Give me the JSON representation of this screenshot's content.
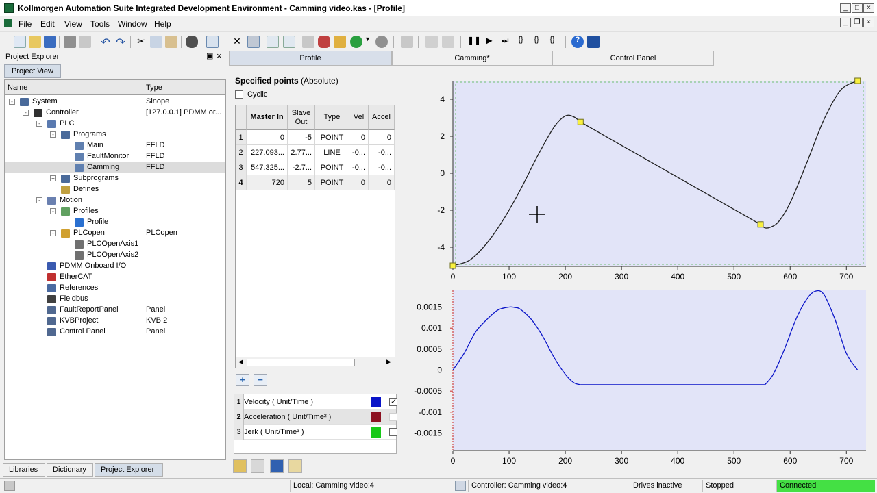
{
  "window": {
    "title": "Kollmorgen Automation Suite Integrated Development Environment - Camming video.kas - [Profile]"
  },
  "menu": [
    "File",
    "Edit",
    "View",
    "Tools",
    "Window",
    "Help"
  ],
  "left_panel": {
    "title": "Project Explorer",
    "tab": "Project View",
    "columns": {
      "name": "Name",
      "type": "Type"
    },
    "tree": [
      {
        "label": "System",
        "type": "Sinope",
        "depth": 0,
        "exp": "-",
        "icon": "system"
      },
      {
        "label": "Controller",
        "type": "[127.0.0.1] PDMM or...",
        "depth": 1,
        "exp": "-",
        "icon": "controller"
      },
      {
        "label": "PLC",
        "type": "",
        "depth": 2,
        "exp": "-",
        "icon": "plc"
      },
      {
        "label": "Programs",
        "type": "",
        "depth": 3,
        "exp": "-",
        "icon": "programs"
      },
      {
        "label": "Main",
        "type": "FFLD",
        "depth": 4,
        "exp": "",
        "icon": "program"
      },
      {
        "label": "FaultMonitor",
        "type": "FFLD",
        "depth": 4,
        "exp": "",
        "icon": "program"
      },
      {
        "label": "Camming",
        "type": "FFLD",
        "depth": 4,
        "exp": "",
        "icon": "program",
        "selected": true
      },
      {
        "label": "Subprograms",
        "type": "",
        "depth": 3,
        "exp": "+",
        "icon": "programs"
      },
      {
        "label": "Defines",
        "type": "",
        "depth": 3,
        "exp": "",
        "icon": "defines"
      },
      {
        "label": "Motion",
        "type": "",
        "depth": 2,
        "exp": "-",
        "icon": "motion"
      },
      {
        "label": "Profiles",
        "type": "",
        "depth": 3,
        "exp": "-",
        "icon": "profiles"
      },
      {
        "label": "Profile",
        "type": "",
        "depth": 4,
        "exp": "",
        "icon": "profile"
      },
      {
        "label": "PLCopen",
        "type": "PLCopen",
        "depth": 3,
        "exp": "-",
        "icon": "plcopen"
      },
      {
        "label": "PLCOpenAxis1",
        "type": "",
        "depth": 4,
        "exp": "",
        "icon": "axis"
      },
      {
        "label": "PLCOpenAxis2",
        "type": "",
        "depth": 4,
        "exp": "",
        "icon": "axis"
      },
      {
        "label": "PDMM Onboard I/O",
        "type": "",
        "depth": 2,
        "exp": "",
        "icon": "io"
      },
      {
        "label": "EtherCAT",
        "type": "",
        "depth": 2,
        "exp": "",
        "icon": "ethercat"
      },
      {
        "label": "References",
        "type": "",
        "depth": 2,
        "exp": "",
        "icon": "references"
      },
      {
        "label": "Fieldbus",
        "type": "",
        "depth": 2,
        "exp": "",
        "icon": "fieldbus"
      },
      {
        "label": "FaultReportPanel",
        "type": "Panel",
        "depth": 2,
        "exp": "",
        "icon": "panel"
      },
      {
        "label": "KVBProject",
        "type": "KVB 2",
        "depth": 2,
        "exp": "",
        "icon": "panel"
      },
      {
        "label": "Control Panel",
        "type": "Panel",
        "depth": 2,
        "exp": "",
        "icon": "panel"
      }
    ],
    "bottom_tabs": [
      "Libraries",
      "Dictionary",
      "Project Explorer"
    ]
  },
  "doc_tabs": [
    "Profile",
    "Camming*",
    "Control Panel"
  ],
  "points": {
    "heading": "Specified points",
    "mode": "(Absolute)",
    "cyclic_label": "Cyclic",
    "headers": [
      "Master In",
      "Slave Out",
      "Type",
      "Vel",
      "Accel"
    ],
    "rows": [
      [
        "1",
        "0",
        "-5",
        "POINT",
        "0",
        "0"
      ],
      [
        "2",
        "227.093...",
        "2.77...",
        "LINE",
        "-0...",
        "-0..."
      ],
      [
        "3",
        "547.325...",
        "-2.7...",
        "POINT",
        "-0...",
        "-0..."
      ],
      [
        "4",
        "720",
        "5",
        "POINT",
        "0",
        "0"
      ]
    ]
  },
  "legend": [
    {
      "num": "1",
      "label": "Velocity ( Unit/Time )",
      "color": "#0a14c8",
      "checked": true
    },
    {
      "num": "2",
      "label": "Acceleration ( Unit/Time² )",
      "color": "#8c1020",
      "checked": false
    },
    {
      "num": "3",
      "label": "Jerk ( Unit/Time³ )",
      "color": "#18c818",
      "checked": false
    }
  ],
  "chart_data": [
    {
      "type": "line",
      "title": "",
      "x": [
        0,
        30,
        60,
        90,
        120,
        150,
        180,
        200,
        215,
        227.09,
        547.33,
        555,
        565,
        580,
        600,
        630,
        660,
        690,
        720
      ],
      "y": [
        -5,
        -4.7,
        -3.8,
        -2.5,
        -0.9,
        0.9,
        2.5,
        3.1,
        3.05,
        2.77,
        -2.77,
        -2.95,
        -2.92,
        -2.6,
        -1.6,
        0.6,
        2.9,
        4.5,
        5
      ],
      "points": [
        [
          0,
          -5
        ],
        [
          227.093,
          2.77
        ],
        [
          547.325,
          -2.77
        ],
        [
          720,
          5
        ]
      ],
      "xlim": [
        0,
        735
      ],
      "ylim": [
        -5,
        5
      ],
      "xticks": [
        0,
        100,
        200,
        300,
        400,
        500,
        600,
        700
      ],
      "yticks": [
        4,
        2,
        0,
        -2,
        -4
      ]
    },
    {
      "type": "line",
      "title": "",
      "series": [
        {
          "name": "Velocity ( Unit/Time )",
          "x": [
            0,
            20,
            40,
            60,
            80,
            100,
            110,
            120,
            140,
            160,
            180,
            200,
            215,
            227,
            300,
            400,
            500,
            555,
            570,
            590,
            610,
            630,
            645,
            660,
            680,
            700,
            720
          ],
          "y": [
            0,
            0.0004,
            0.0009,
            0.0012,
            0.00143,
            0.0015,
            0.00149,
            0.00145,
            0.0012,
            0.0008,
            0.0003,
            -0.0001,
            -0.0003,
            -0.00035,
            -0.00035,
            -0.00035,
            -0.00035,
            -0.00035,
            -0.0001,
            0.0005,
            0.0012,
            0.0017,
            0.00188,
            0.0018,
            0.0012,
            0.0004,
            0
          ]
        }
      ],
      "xlim": [
        0,
        735
      ],
      "ylim": [
        -0.0019,
        0.0019
      ],
      "xticks": [
        0,
        100,
        200,
        300,
        400,
        500,
        600,
        700
      ],
      "yticks": [
        "0.0015",
        "0.001",
        "0.0005",
        "0",
        "-0.0005",
        "-0.001",
        "-0.0015"
      ]
    }
  ],
  "status": {
    "local": "Local: Camming video:4",
    "controller": "Controller: Camming video:4",
    "drives": "Drives inactive",
    "state": "Stopped",
    "connection": "Connected"
  }
}
